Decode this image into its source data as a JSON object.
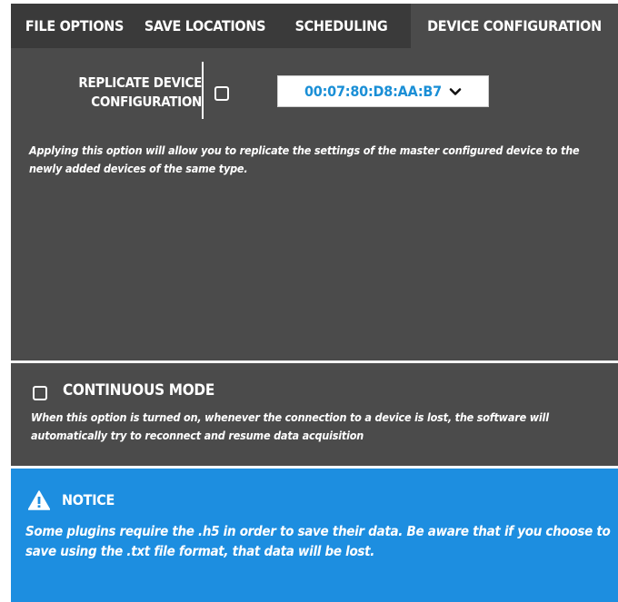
{
  "tabs": [
    {
      "label": "FILE OPTIONS"
    },
    {
      "label": "SAVE LOCATIONS"
    },
    {
      "label": "SCHEDULING"
    },
    {
      "label": "DEVICE CONFIGURATION"
    }
  ],
  "active_tab": "DEVICE CONFIGURATION",
  "replicate": {
    "label_line1": "REPLICATE DEVICE",
    "label_line2": "CONFIGURATION",
    "checked": false,
    "device_select_value": "00:07:80:D8:AA:B7",
    "description": "Applying this option will allow you to replicate the settings of the master configured device to the newly added devices of the same type."
  },
  "continuous": {
    "title": "CONTINUOUS MODE",
    "checked": false,
    "description": "When this option is turned on, whenever the connection to a device is lost, the software will automatically try to reconnect and resume data acquisition"
  },
  "notice": {
    "icon": "warning-icon",
    "title": "NOTICE",
    "text": "Some plugins require the .h5 in order to save their data. Be aware that if you choose to save using the .txt file format, that data will be lost."
  },
  "colors": {
    "tabbar_bg": "#3a3a3a",
    "panel_bg": "#4b4b4b",
    "notice_bg": "#1d8ee0",
    "select_text": "#1a8fd6"
  }
}
